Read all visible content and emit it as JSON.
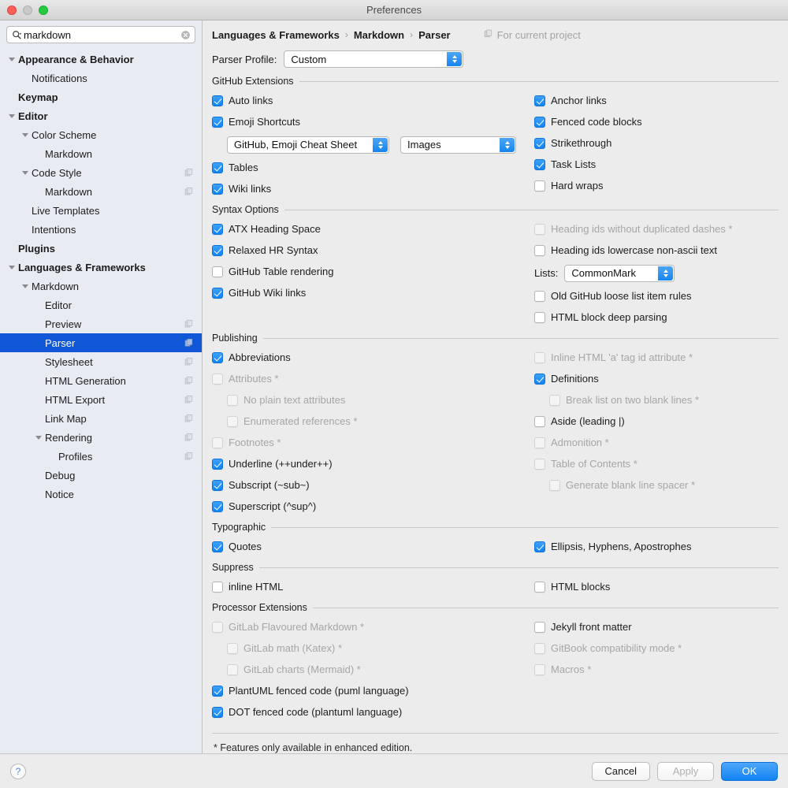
{
  "window": {
    "title": "Preferences",
    "traffic_lights": [
      "close",
      "minimize",
      "zoom"
    ]
  },
  "sidebar": {
    "search": {
      "value": "markdown",
      "placeholder": "",
      "icon": "search-icon",
      "clear_icon": "clear-icon"
    },
    "items": [
      {
        "label": "Appearance & Behavior",
        "indent": 0,
        "bold": true,
        "arrow": true,
        "copy": false,
        "selected": false
      },
      {
        "label": "Notifications",
        "indent": 1,
        "bold": false,
        "arrow": false,
        "copy": false,
        "selected": false
      },
      {
        "label": "Keymap",
        "indent": 0,
        "bold": true,
        "arrow": false,
        "copy": false,
        "selected": false
      },
      {
        "label": "Editor",
        "indent": 0,
        "bold": true,
        "arrow": true,
        "copy": false,
        "selected": false
      },
      {
        "label": "Color Scheme",
        "indent": 1,
        "bold": false,
        "arrow": true,
        "copy": false,
        "selected": false
      },
      {
        "label": "Markdown",
        "indent": 2,
        "bold": false,
        "arrow": false,
        "copy": false,
        "selected": false
      },
      {
        "label": "Code Style",
        "indent": 1,
        "bold": false,
        "arrow": true,
        "copy": true,
        "selected": false
      },
      {
        "label": "Markdown",
        "indent": 2,
        "bold": false,
        "arrow": false,
        "copy": true,
        "selected": false
      },
      {
        "label": "Live Templates",
        "indent": 1,
        "bold": false,
        "arrow": false,
        "copy": false,
        "selected": false
      },
      {
        "label": "Intentions",
        "indent": 1,
        "bold": false,
        "arrow": false,
        "copy": false,
        "selected": false
      },
      {
        "label": "Plugins",
        "indent": 0,
        "bold": true,
        "arrow": false,
        "copy": false,
        "selected": false
      },
      {
        "label": "Languages & Frameworks",
        "indent": 0,
        "bold": true,
        "arrow": true,
        "copy": false,
        "selected": false
      },
      {
        "label": "Markdown",
        "indent": 1,
        "bold": false,
        "arrow": true,
        "copy": false,
        "selected": false
      },
      {
        "label": "Editor",
        "indent": 2,
        "bold": false,
        "arrow": false,
        "copy": false,
        "selected": false
      },
      {
        "label": "Preview",
        "indent": 2,
        "bold": false,
        "arrow": false,
        "copy": true,
        "selected": false
      },
      {
        "label": "Parser",
        "indent": 2,
        "bold": false,
        "arrow": false,
        "copy": true,
        "selected": true
      },
      {
        "label": "Stylesheet",
        "indent": 2,
        "bold": false,
        "arrow": false,
        "copy": true,
        "selected": false
      },
      {
        "label": "HTML Generation",
        "indent": 2,
        "bold": false,
        "arrow": false,
        "copy": true,
        "selected": false
      },
      {
        "label": "HTML Export",
        "indent": 2,
        "bold": false,
        "arrow": false,
        "copy": true,
        "selected": false
      },
      {
        "label": "Link Map",
        "indent": 2,
        "bold": false,
        "arrow": false,
        "copy": true,
        "selected": false
      },
      {
        "label": "Rendering",
        "indent": 2,
        "bold": false,
        "arrow": true,
        "copy": true,
        "selected": false
      },
      {
        "label": "Profiles",
        "indent": 3,
        "bold": false,
        "arrow": false,
        "copy": true,
        "selected": false
      },
      {
        "label": "Debug",
        "indent": 2,
        "bold": false,
        "arrow": false,
        "copy": false,
        "selected": false
      },
      {
        "label": "Notice",
        "indent": 2,
        "bold": false,
        "arrow": false,
        "copy": false,
        "selected": false
      }
    ]
  },
  "main": {
    "breadcrumb": [
      "Languages & Frameworks",
      "Markdown",
      "Parser"
    ],
    "breadcrumb_separator": "›",
    "for_current_project": "For current project",
    "profile": {
      "label": "Parser Profile:",
      "value": "Custom"
    },
    "sections": {
      "github_extensions": {
        "title": "GitHub Extensions",
        "left": [
          {
            "label": "Auto links",
            "checked": true,
            "disabled": false,
            "indent": 0
          },
          {
            "label": "Emoji Shortcuts",
            "checked": true,
            "disabled": false,
            "indent": 0
          },
          {
            "label": "Tables",
            "checked": true,
            "disabled": false,
            "indent": 0
          },
          {
            "label": "Wiki links",
            "checked": true,
            "disabled": false,
            "indent": 0
          }
        ],
        "emoji_combo_1": "GitHub, Emoji Cheat Sheet",
        "emoji_combo_2": "Images",
        "right": [
          {
            "label": "Anchor links",
            "checked": true,
            "disabled": false,
            "indent": 0
          },
          {
            "label": "Fenced code blocks",
            "checked": true,
            "disabled": false,
            "indent": 0
          },
          {
            "label": "Strikethrough",
            "checked": true,
            "disabled": false,
            "indent": 0
          },
          {
            "label": "Task Lists",
            "checked": true,
            "disabled": false,
            "indent": 0
          },
          {
            "label": "Hard wraps",
            "checked": false,
            "disabled": false,
            "indent": 0
          }
        ]
      },
      "syntax_options": {
        "title": "Syntax Options",
        "left": [
          {
            "label": "ATX Heading Space",
            "checked": true,
            "disabled": false,
            "indent": 0
          },
          {
            "label": "Relaxed HR Syntax",
            "checked": true,
            "disabled": false,
            "indent": 0
          },
          {
            "label": "GitHub Table rendering",
            "checked": false,
            "disabled": false,
            "indent": 0
          },
          {
            "label": "GitHub Wiki links",
            "checked": true,
            "disabled": false,
            "indent": 0
          }
        ],
        "right_top": [
          {
            "label": "Heading ids without duplicated dashes *",
            "checked": false,
            "disabled": true,
            "indent": 0
          },
          {
            "label": "Heading ids lowercase non-ascii text",
            "checked": false,
            "disabled": false,
            "indent": 0
          }
        ],
        "lists_label": "Lists:",
        "lists_value": "CommonMark",
        "right_bottom": [
          {
            "label": "Old GitHub loose list item rules",
            "checked": false,
            "disabled": false,
            "indent": 0
          },
          {
            "label": "HTML block deep parsing",
            "checked": false,
            "disabled": false,
            "indent": 0
          }
        ]
      },
      "publishing": {
        "title": "Publishing",
        "left": [
          {
            "label": "Abbreviations",
            "checked": true,
            "disabled": false,
            "indent": 0
          },
          {
            "label": "Attributes *",
            "checked": false,
            "disabled": true,
            "indent": 0
          },
          {
            "label": "No plain text attributes",
            "checked": false,
            "disabled": true,
            "indent": 1
          },
          {
            "label": "Enumerated references *",
            "checked": false,
            "disabled": true,
            "indent": 1
          },
          {
            "label": "Footnotes *",
            "checked": false,
            "disabled": true,
            "indent": 0
          },
          {
            "label": "Underline (++under++)",
            "checked": true,
            "disabled": false,
            "indent": 0
          },
          {
            "label": "Subscript (~sub~)",
            "checked": true,
            "disabled": false,
            "indent": 0
          },
          {
            "label": "Superscript (^sup^)",
            "checked": true,
            "disabled": false,
            "indent": 0
          }
        ],
        "right": [
          {
            "label": "Inline HTML 'a' tag id attribute *",
            "checked": false,
            "disabled": true,
            "indent": 0
          },
          {
            "label": "Definitions",
            "checked": true,
            "disabled": false,
            "indent": 0
          },
          {
            "label": "Break list on two blank lines *",
            "checked": false,
            "disabled": true,
            "indent": 1
          },
          {
            "label": "Aside (leading |)",
            "checked": false,
            "disabled": false,
            "indent": 0
          },
          {
            "label": "Admonition *",
            "checked": false,
            "disabled": true,
            "indent": 0
          },
          {
            "label": "Table of Contents *",
            "checked": false,
            "disabled": true,
            "indent": 0
          },
          {
            "label": "Generate blank line spacer *",
            "checked": false,
            "disabled": true,
            "indent": 1
          }
        ]
      },
      "typographic": {
        "title": "Typographic",
        "left": [
          {
            "label": "Quotes",
            "checked": true,
            "disabled": false,
            "indent": 0
          }
        ],
        "right": [
          {
            "label": "Ellipsis, Hyphens, Apostrophes",
            "checked": true,
            "disabled": false,
            "indent": 0
          }
        ]
      },
      "suppress": {
        "title": "Suppress",
        "left": [
          {
            "label": "inline HTML",
            "checked": false,
            "disabled": false,
            "indent": 0
          }
        ],
        "right": [
          {
            "label": "HTML blocks",
            "checked": false,
            "disabled": false,
            "indent": 0
          }
        ]
      },
      "processor_extensions": {
        "title": "Processor Extensions",
        "left": [
          {
            "label": "GitLab Flavoured Markdown *",
            "checked": false,
            "disabled": true,
            "indent": 0
          },
          {
            "label": "GitLab math (Katex) *",
            "checked": false,
            "disabled": true,
            "indent": 1
          },
          {
            "label": "GitLab charts (Mermaid) *",
            "checked": false,
            "disabled": true,
            "indent": 1
          },
          {
            "label": "PlantUML fenced code (puml language)",
            "checked": true,
            "disabled": false,
            "indent": 0
          },
          {
            "label": "DOT fenced code (plantuml language)",
            "checked": true,
            "disabled": false,
            "indent": 0
          }
        ],
        "right": [
          {
            "label": "Jekyll front matter",
            "checked": false,
            "disabled": false,
            "indent": 0
          },
          {
            "label": "GitBook compatibility mode *",
            "checked": false,
            "disabled": true,
            "indent": 0
          },
          {
            "label": "Macros *",
            "checked": false,
            "disabled": true,
            "indent": 0
          }
        ]
      }
    },
    "footnote": "* Features only available in enhanced edition."
  },
  "bottom_bar": {
    "help_label": "?",
    "cancel": "Cancel",
    "apply": "Apply",
    "ok": "OK"
  },
  "colors": {
    "accent": "#1283f4",
    "selection": "#1057d8",
    "sidebar_bg": "#e8ecf2",
    "panel_bg": "#ececec",
    "disabled_text": "#a6a6a6"
  }
}
